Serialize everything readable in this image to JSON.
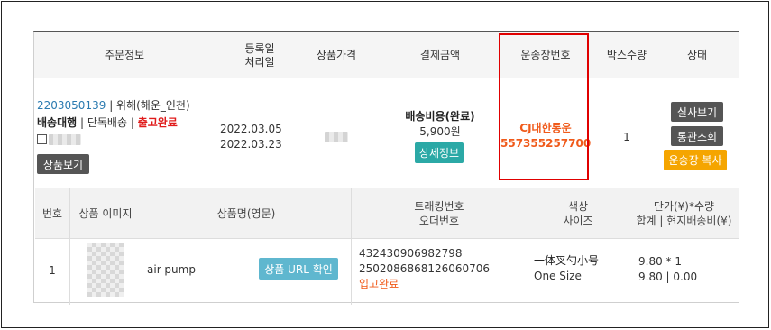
{
  "order_table": {
    "headers": {
      "order_info": "주문정보",
      "reg_date": "등록일",
      "proc_date": "처리일",
      "price": "상품가격",
      "payment": "결제금액",
      "tracking": "운송장번호",
      "box_qty": "박스수량",
      "status": "상태"
    },
    "order": {
      "order_no": "2203050139",
      "recipient": "| 위해(해운_인천)",
      "service": "배송대행",
      "sep1": " | ",
      "delivery_type": "단독배송",
      "sep2": " | ",
      "status_text": "출고완료",
      "view_product_btn": "상품보기",
      "reg_date": "2022.03.05",
      "proc_date": "2022.03.23",
      "payment_label": "배송비용(완료)",
      "payment_amount": "5,900원",
      "detail_btn": "상세정보",
      "carrier": "CJ대한통운",
      "tracking_no": "557355257700",
      "box_qty": "1",
      "photo_btn": "실사보기",
      "customs_btn": "통관조회",
      "copy_tracking_btn": "운송장 복사"
    }
  },
  "item_table": {
    "headers": {
      "no": "번호",
      "image": "상품 이미지",
      "name": "상품명(영문)",
      "tracking": "트래킹번호",
      "order_no": "오더번호",
      "color": "색상",
      "size": "사이즈",
      "unit_price": "단가(¥)*수량",
      "total": "합계 | 현지배송비(¥)"
    },
    "row": {
      "no": "1",
      "name": "air pump",
      "url_btn": "상품 URL 확인",
      "tracking_no": "432430906982798",
      "order_no": "2502086868126060706",
      "inbound_status": "입고완료",
      "color": "一体叉勺小号",
      "size": "One Size",
      "unit_qty": "9.80 * 1",
      "total": "9.80 | 0.00"
    }
  },
  "colors": {
    "highlight_box": "#e00000",
    "status_red": "#e01b1b",
    "carrier_orange": "#f05a1a",
    "teal_button": "#2ba9a6",
    "amber_button": "#f5a500"
  }
}
